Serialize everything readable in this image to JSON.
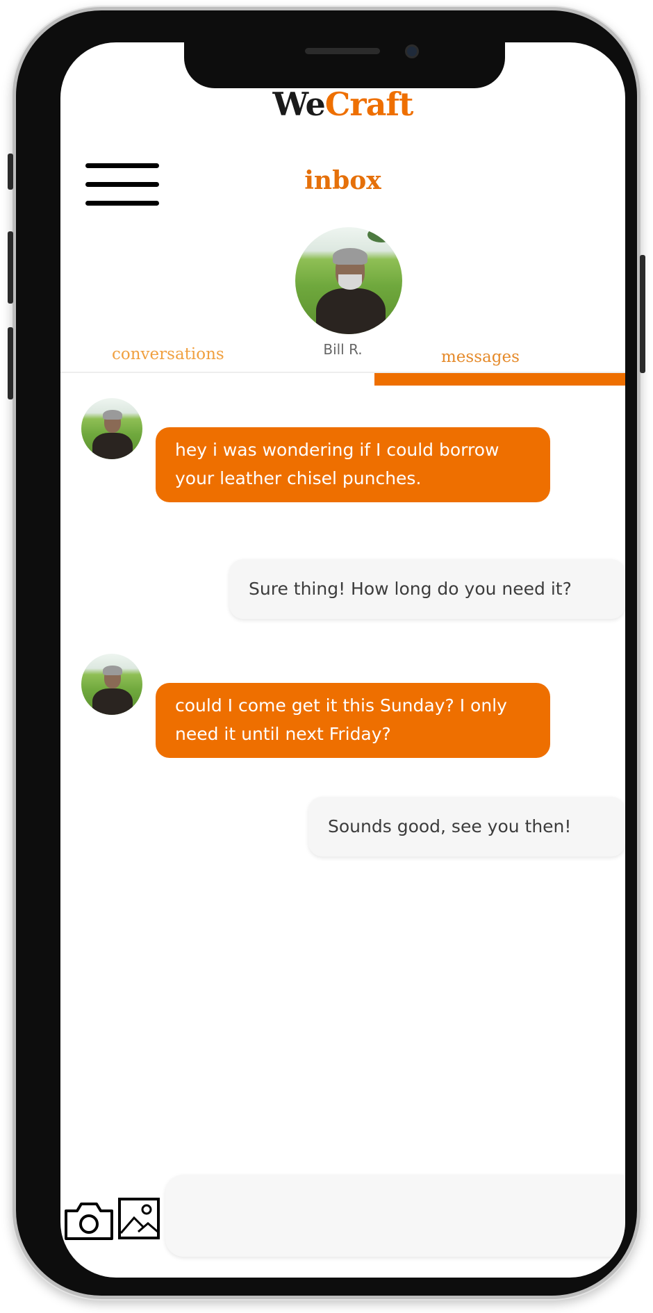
{
  "app": {
    "logo_part1": "We",
    "logo_part2": "Craft",
    "title": "inbox",
    "accent_color": "#ee6f00"
  },
  "contact": {
    "name": "Bill R."
  },
  "tabs": [
    {
      "label": "conversations",
      "active": false
    },
    {
      "label": "messages",
      "active": true
    }
  ],
  "messages": [
    {
      "from": "contact",
      "text": "hey i was wondering if I could borrow your leather chisel punches."
    },
    {
      "from": "me",
      "text": "Sure thing! How long do you need it?"
    },
    {
      "from": "contact",
      "text": "could I come get it this Sunday? I only need it until next Friday?"
    },
    {
      "from": "me",
      "text": "Sounds good, see you then!"
    }
  ],
  "composer": {
    "placeholder": "",
    "icons": [
      "camera-icon",
      "image-icon"
    ]
  }
}
